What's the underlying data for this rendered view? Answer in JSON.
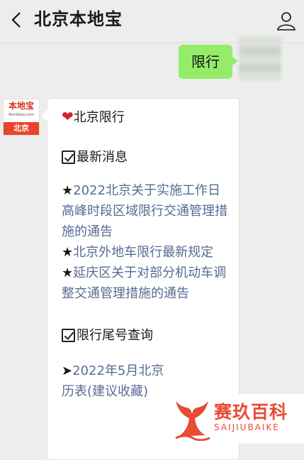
{
  "header": {
    "title": "北京本地宝"
  },
  "outgoing": {
    "text": "限行"
  },
  "bot_avatar": {
    "logo_text": "本地宝",
    "logo_sub": "Bendibao.com",
    "city": "北京"
  },
  "message": {
    "heading": "北京限行",
    "section1_title": "最新消息",
    "news": [
      {
        "star": "★",
        "text": "2022北京关于实施工作日高峰时段区域限行交通管理措施的通告"
      },
      {
        "star": "★",
        "text": "北京外地车限行最新规定"
      },
      {
        "star": "★",
        "text": "延庆区关于对部分机动车调整交通管理措施的通告"
      }
    ],
    "section2_title": "限行尾号查询",
    "partial": {
      "arrow": "➤",
      "text": "2022年5月北京",
      "text2": "历表(建议收藏)"
    }
  },
  "watermark": {
    "brand": "赛玖百科",
    "sub": "SAIJIUBAIKE"
  },
  "colors": {
    "bubble_green": "#95ec69",
    "link_blue": "#576b95",
    "logo_red": "#e8452a"
  }
}
